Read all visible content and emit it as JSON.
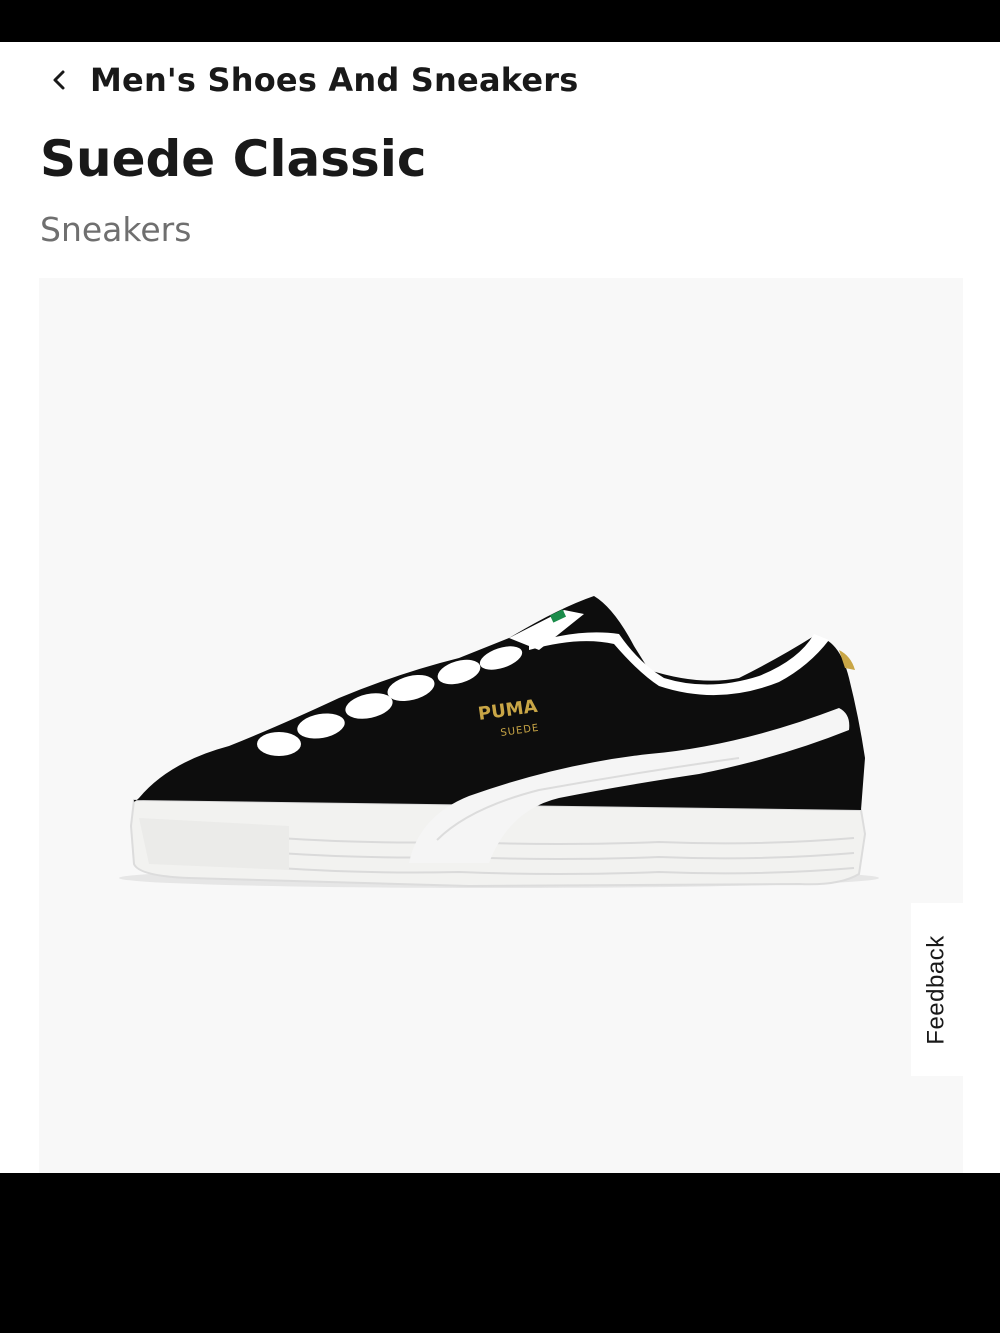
{
  "header": {
    "breadcrumb_label": "Men's Shoes And Sneakers",
    "back_icon": "chevron-left-icon"
  },
  "product": {
    "title": "Suede Classic",
    "subtitle": "Sneakers",
    "image_alt": "Black Puma Suede Classic sneaker with white formstrip and white sole",
    "logo_text": "PUMA",
    "logo_subtext": "SUEDE"
  },
  "feedback": {
    "label": "Feedback"
  },
  "colors": {
    "image_background": "#f8f8f8",
    "upper": "#0d0d0d",
    "formstrip": "#f5f5f5",
    "sole": "#f0f0ee",
    "logo_gold": "#c9a646",
    "text_primary": "#191919",
    "text_secondary": "#6f6f6f"
  }
}
